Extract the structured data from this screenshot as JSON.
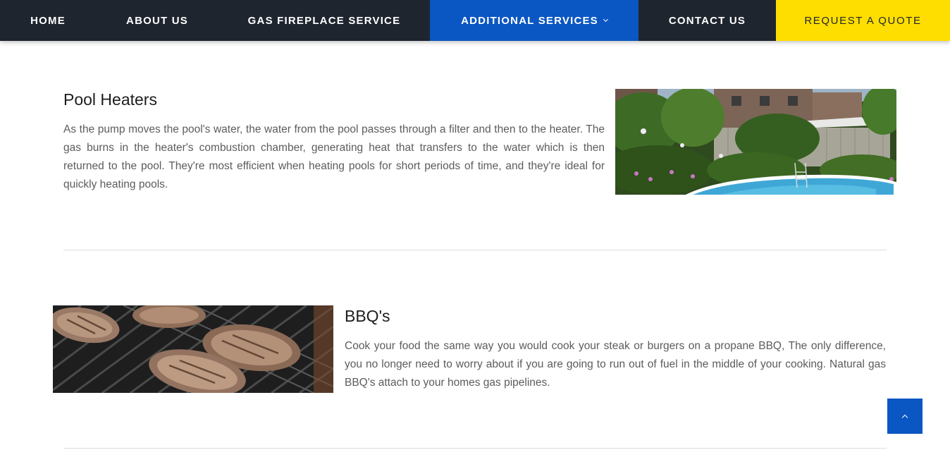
{
  "nav": {
    "home": "HOME",
    "about": "ABOUT US",
    "gas_fireplace": "GAS FIREPLACE SERVICE",
    "additional": "ADDITIONAL SERVICES",
    "contact": "CONTACT US",
    "quote": "REQUEST A QUOTE",
    "active_color": "#0a56c2",
    "quote_color": "#fede00",
    "bar_color": "#1f252f"
  },
  "sections": [
    {
      "title": "Pool Heaters",
      "text": "As the pump moves the pool's water, the water from the pool passes through a filter and then to the heater. The gas burns in the heater's combustion chamber, generating heat that transfers to the water which is then returned to the pool. They're most efficient when heating pools for short periods of time, and they're ideal for quickly heating pools.",
      "image": "pool-photo"
    },
    {
      "title": "BBQ's",
      "text": "Cook your food the same way you would cook your steak or burgers on a propane BBQ, The only difference, you no longer need to worry about if you are going to run out of fuel in the middle of your cooking. Natural gas BBQ's attach to your homes gas pipelines.",
      "image": "bbq-grill-photo"
    }
  ],
  "scroll_top": {
    "icon": "chevron-up-icon"
  }
}
